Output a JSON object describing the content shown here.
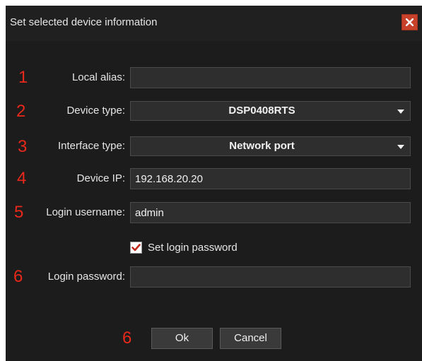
{
  "dialog": {
    "title": "Set selected device information",
    "close_icon": "close-icon",
    "close_color": "#c8412b"
  },
  "annotations": {
    "n1": "1",
    "n2": "2",
    "n3": "3",
    "n4": "4",
    "n5": "5",
    "n6a": "6",
    "n6b": "6",
    "color": "#e8281a"
  },
  "form": {
    "local_alias": {
      "label": "Local alias:",
      "value": ""
    },
    "device_type": {
      "label": "Device type:",
      "value": "DSP0408RTS"
    },
    "interface_type": {
      "label": "Interface type:",
      "value": "Network port"
    },
    "device_ip": {
      "label": "Device IP:",
      "value": "192.168.20.20"
    },
    "login_username": {
      "label": "Login username:",
      "value": "admin"
    },
    "set_password": {
      "label": "Set login password",
      "checked": true
    },
    "login_password": {
      "label": "Login password:",
      "value": ""
    }
  },
  "buttons": {
    "ok": "Ok",
    "cancel": "Cancel"
  }
}
